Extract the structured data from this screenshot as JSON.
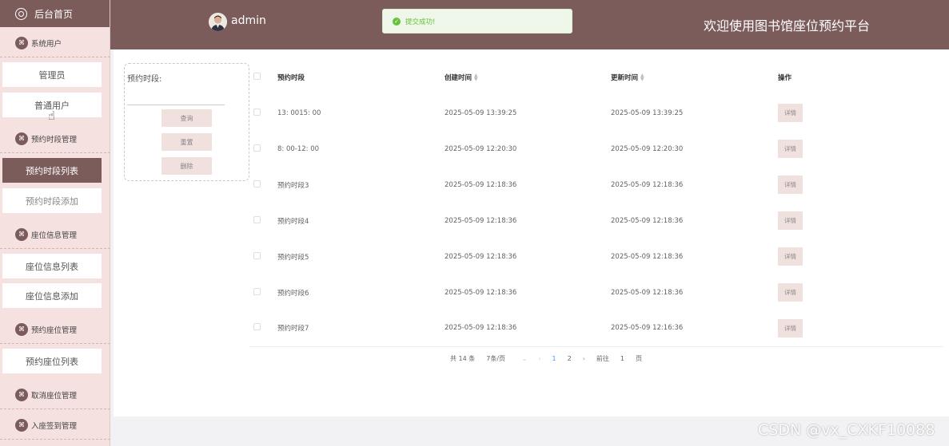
{
  "sidebar": {
    "home_label": "后台首页",
    "groups": [
      {
        "label": "系统用户",
        "items": [
          "管理员",
          "普通用户"
        ]
      },
      {
        "label": "预约时段管理",
        "items": [
          "预约时段列表",
          "预约时段添加"
        ]
      },
      {
        "label": "座位信息管理",
        "items": [
          "座位信息列表",
          "座位信息添加"
        ]
      },
      {
        "label": "预约座位管理",
        "items": [
          "预约座位列表"
        ]
      },
      {
        "label": "取消座位管理",
        "items": []
      },
      {
        "label": "入座签到管理",
        "items": []
      }
    ],
    "active_item": "预约时段列表"
  },
  "header": {
    "user": "admin",
    "toast": "提交成功!",
    "welcome": "欢迎使用图书馆座位预约平台"
  },
  "search": {
    "label": "预约时段:",
    "value": "",
    "buttons": {
      "query": "查询",
      "reset": "重置",
      "delete": "删除"
    }
  },
  "table": {
    "headers": {
      "name": "预约时段",
      "created": "创建时间",
      "updated": "更新时间",
      "action": "操作"
    },
    "rows": [
      {
        "name": "13: 0015: 00",
        "created": "2025-05-09 13:39:25",
        "updated": "2025-05-09 13:39:25",
        "action": "详情"
      },
      {
        "name": "8: 00-12: 00",
        "created": "2025-05-09 12:20:30",
        "updated": "2025-05-09 12:20:30",
        "action": "详情"
      },
      {
        "name": "预约时段3",
        "created": "2025-05-09 12:18:36",
        "updated": "2025-05-09 12:18:36",
        "action": "详情"
      },
      {
        "name": "预约时段4",
        "created": "2025-05-09 12:18:36",
        "updated": "2025-05-09 12:18:36",
        "action": "详情"
      },
      {
        "name": "预约时段5",
        "created": "2025-05-09 12:18:36",
        "updated": "2025-05-09 12:18:36",
        "action": "详情"
      },
      {
        "name": "预约时段6",
        "created": "2025-05-09 12:18:36",
        "updated": "2025-05-09 12:18:36",
        "action": "详情"
      },
      {
        "name": "预约时段7",
        "created": "2025-05-09 12:18:36",
        "updated": "2025-05-09 12:16:36",
        "action": "详情"
      }
    ]
  },
  "pagination": {
    "total": "共 14 条",
    "page_size": "7条/页",
    "pages": [
      "1",
      "2"
    ],
    "current": "1",
    "goto_label": "前往",
    "goto_value": "1",
    "page_unit": "页"
  },
  "watermark": "CSDN @vx_CXKF10088",
  "colors": {
    "primary": "#7c5b5b",
    "sidebar_bg": "#f5e1df",
    "button_bg": "#f0e0de",
    "success": "#67c23a",
    "link": "#409eff"
  }
}
